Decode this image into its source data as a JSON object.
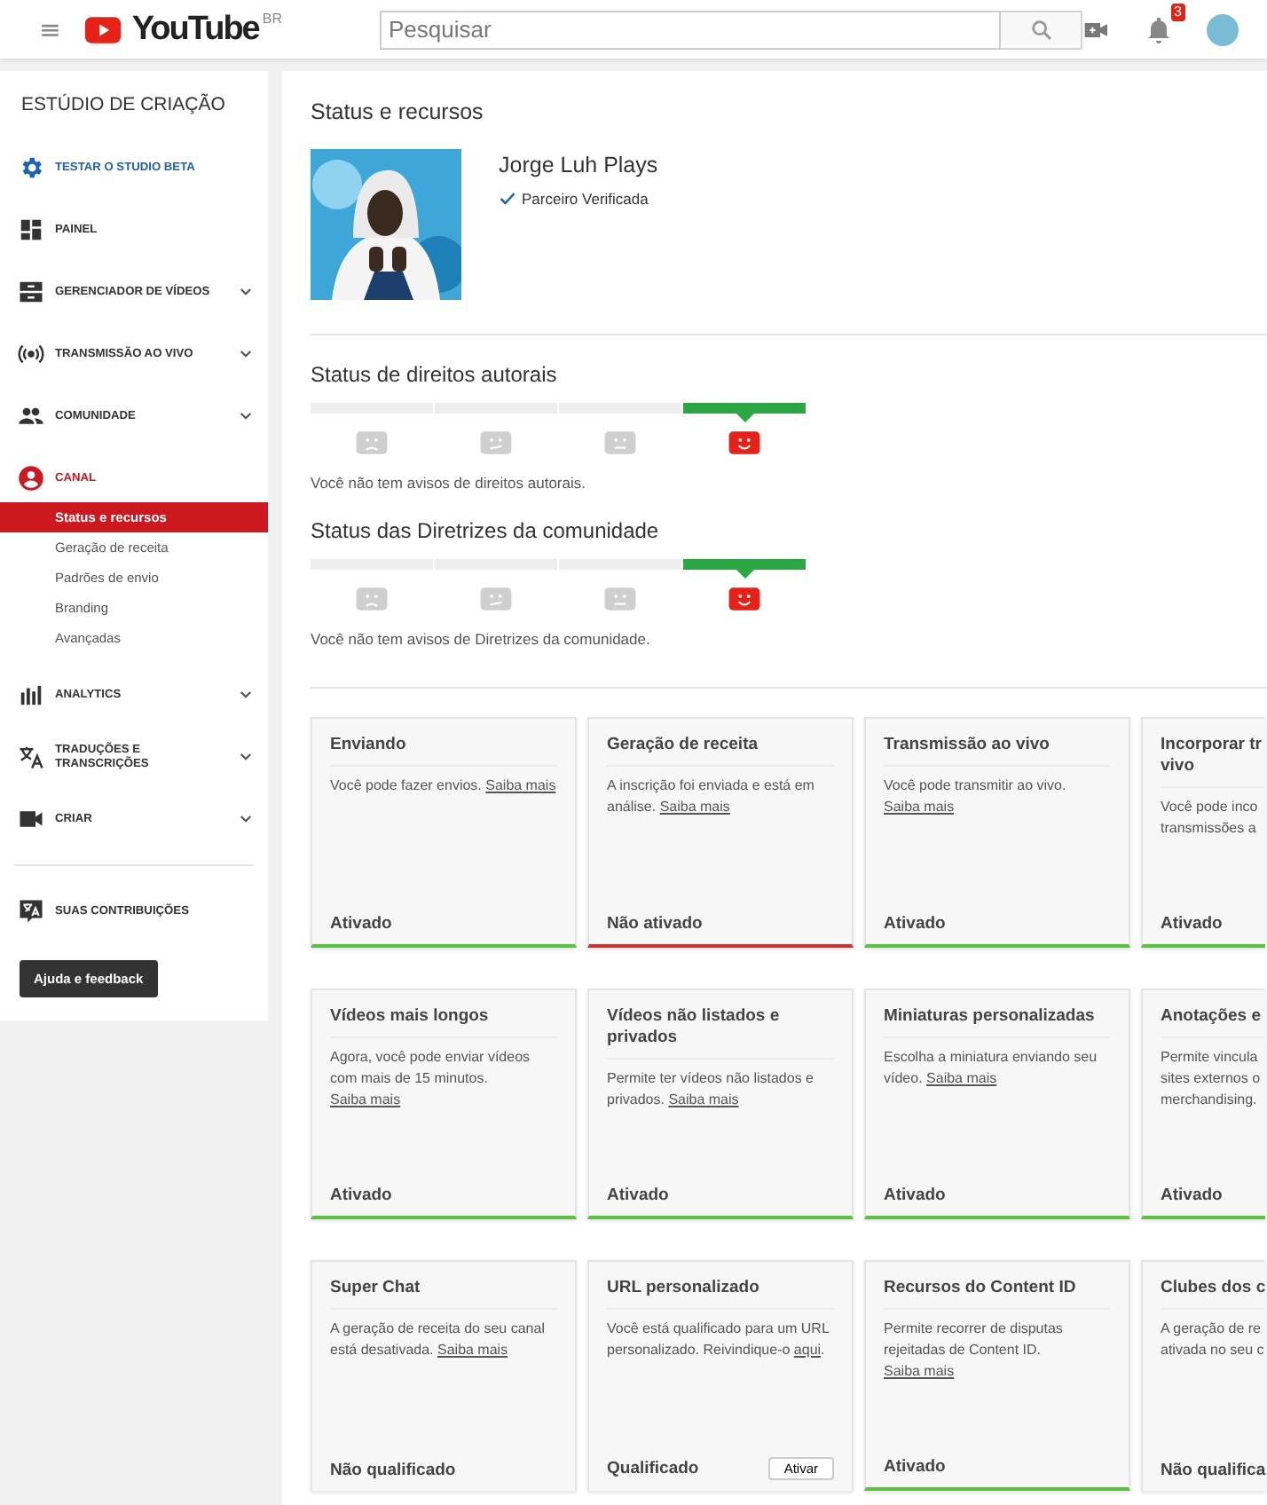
{
  "header": {
    "logo": "YouTube",
    "region": "BR",
    "search": {
      "placeholder": "Pesquisar"
    },
    "notifications": "3"
  },
  "sidebar": {
    "title": "ESTÚDIO DE CRIAÇÃO",
    "items": [
      {
        "label": "TESTAR O STUDIO BETA",
        "kind": "beta",
        "selected": false,
        "expandable": false
      },
      {
        "label": "PAINEL",
        "kind": "nav",
        "selected": false,
        "expandable": false
      },
      {
        "label": "GERENCIADOR DE VÍDEOS",
        "kind": "nav",
        "selected": false,
        "expandable": true
      },
      {
        "label": "TRANSMISSÃO AO VIVO",
        "kind": "nav",
        "selected": false,
        "expandable": true
      },
      {
        "label": "COMUNIDADE",
        "kind": "nav",
        "selected": false,
        "expandable": true
      },
      {
        "label": "CANAL",
        "kind": "nav",
        "selected": true,
        "expandable": false,
        "children": [
          {
            "label": "Status e recursos",
            "selected": true
          },
          {
            "label": "Geração de receita",
            "selected": false
          },
          {
            "label": "Padrões de envio",
            "selected": false
          },
          {
            "label": "Branding",
            "selected": false
          },
          {
            "label": "Avançadas",
            "selected": false
          }
        ]
      },
      {
        "label": "ANALYTICS",
        "kind": "nav",
        "selected": false,
        "expandable": true
      },
      {
        "label": "TRADUÇÕES E TRANSCRIÇÕES",
        "kind": "nav",
        "selected": false,
        "expandable": true
      },
      {
        "label": "CRIAR",
        "kind": "nav",
        "selected": false,
        "expandable": true
      },
      {
        "label": "SUAS CONTRIBUIÇÕES",
        "kind": "footer",
        "selected": false,
        "expandable": false
      }
    ],
    "help_button": "Ajuda e feedback"
  },
  "main": {
    "title": "Status e recursos",
    "profile": {
      "name": "Jorge Luh Plays",
      "badge": "Parceiro Verificada"
    },
    "meters": [
      {
        "title": "Status de direitos autorais",
        "note": "Você não tem avisos de direitos autorais.",
        "segments": [
          {
            "selected": false
          },
          {
            "selected": false
          },
          {
            "selected": false
          },
          {
            "selected": true
          }
        ]
      },
      {
        "title": "Status das Diretrizes da comunidade",
        "note": "Você não tem avisos de Diretrizes da comunidade.",
        "segments": [
          {
            "selected": false
          },
          {
            "selected": false
          },
          {
            "selected": false
          },
          {
            "selected": true
          }
        ]
      }
    ],
    "cards": [
      {
        "title": "Enviando",
        "text": "Você pode fazer envios.",
        "link": "Saiba mais",
        "status": "Ativado",
        "kind": "active"
      },
      {
        "title": "Geração de receita",
        "text": "A inscrição foi enviada e está em análise.",
        "link": "Saiba mais",
        "status": "Não ativado",
        "kind": "inactive"
      },
      {
        "title": "Transmissão ao vivo",
        "text": "Você pode transmitir ao vivo.",
        "link": "Saiba mais",
        "status": "Ativado",
        "kind": "active"
      },
      {
        "title": "Incorporar tr\nvivo",
        "text": "Você pode inco\ntransmissões a",
        "status": "Ativado",
        "kind": "active"
      },
      {
        "title": "Vídeos mais longos",
        "text": "Agora, você pode enviar vídeos com mais de 15 minutos.",
        "link": "Saiba mais",
        "status": "Ativado",
        "kind": "active"
      },
      {
        "title": "Vídeos não listados e privados",
        "text": "Permite ter vídeos não listados e privados.",
        "link": "Saiba mais",
        "status": "Ativado",
        "kind": "active"
      },
      {
        "title": "Miniaturas personalizadas",
        "text": "Escolha a miniatura enviando seu vídeo.",
        "link": "Saiba mais",
        "status": "Ativado",
        "kind": "active"
      },
      {
        "title": "Anotações e",
        "text": "Permite vincula\nsites externos o\nmerchandising.",
        "status": "Ativado",
        "kind": "active"
      },
      {
        "title": "Super Chat",
        "text": "A geração de receita do seu canal está desativada.",
        "link": "Saiba mais",
        "status": "Não qualificado",
        "kind": "plain"
      },
      {
        "title": "URL personalizado",
        "text": "Você está qualificado para um URL personalizado. Reivindique-o",
        "link": "aqui",
        "after": ".",
        "status": "Qualificado",
        "kind": "plain",
        "action": "Ativar"
      },
      {
        "title": "Recursos do Content ID",
        "text": "Permite recorrer de disputas rejeitadas de Content ID.",
        "link": "Saiba mais",
        "status": "Ativado",
        "kind": "active"
      },
      {
        "title": "Clubes dos c",
        "text": "A geração de re\nativada no seu c",
        "status": "Não qualifica",
        "kind": "plain"
      }
    ]
  }
}
